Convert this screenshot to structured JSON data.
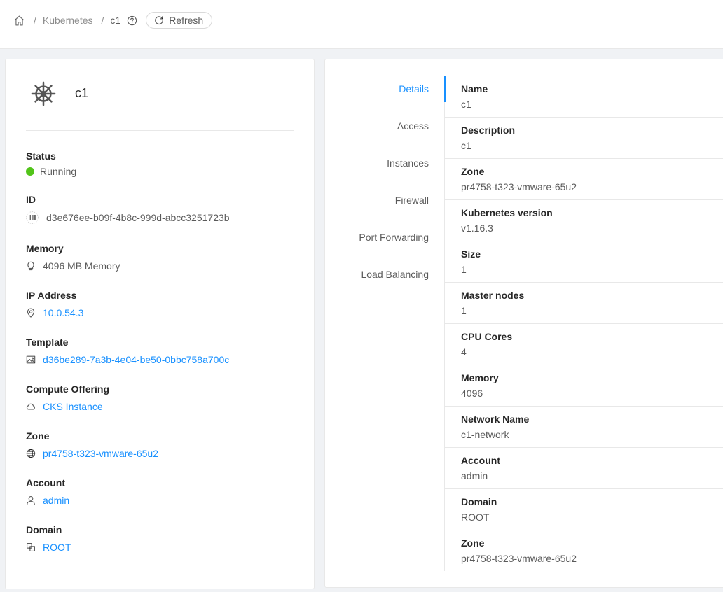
{
  "breadcrumb": {
    "home_icon": "home-icon",
    "sep": "/",
    "section": "Kubernetes",
    "current": "c1",
    "help_icon": "question-circle-icon",
    "refresh_label": "Refresh"
  },
  "resource": {
    "icon": "kubernetes-helm-icon",
    "name": "c1"
  },
  "info": {
    "status_label": "Status",
    "status_value": "Running",
    "status_color": "#52c41a",
    "id_label": "ID",
    "id_value": "d3e676ee-b09f-4b8c-999d-abcc3251723b",
    "memory_label": "Memory",
    "memory_value": "4096 MB Memory",
    "ip_label": "IP Address",
    "ip_value": "10.0.54.3",
    "template_label": "Template",
    "template_value": "d36be289-7a3b-4e04-be50-0bbc758a700c",
    "offering_label": "Compute Offering",
    "offering_value": "CKS Instance",
    "zone_label": "Zone",
    "zone_value": "pr4758-t323-vmware-65u2",
    "account_label": "Account",
    "account_value": "admin",
    "domain_label": "Domain",
    "domain_value": "ROOT"
  },
  "tabs": [
    {
      "label": "Details",
      "active": true
    },
    {
      "label": "Access",
      "active": false
    },
    {
      "label": "Instances",
      "active": false
    },
    {
      "label": "Firewall",
      "active": false
    },
    {
      "label": "Port Forwarding",
      "active": false
    },
    {
      "label": "Load Balancing",
      "active": false
    }
  ],
  "details": [
    {
      "label": "Name",
      "value": "c1"
    },
    {
      "label": "Description",
      "value": "c1"
    },
    {
      "label": "Zone",
      "value": "pr4758-t323-vmware-65u2"
    },
    {
      "label": "Kubernetes version",
      "value": "v1.16.3"
    },
    {
      "label": "Size",
      "value": "1"
    },
    {
      "label": "Master nodes",
      "value": "1"
    },
    {
      "label": "CPU Cores",
      "value": "4"
    },
    {
      "label": "Memory",
      "value": "4096"
    },
    {
      "label": "Network Name",
      "value": "c1-network"
    },
    {
      "label": "Account",
      "value": "admin"
    },
    {
      "label": "Domain",
      "value": "ROOT"
    },
    {
      "label": "Zone",
      "value": "pr4758-t323-vmware-65u2"
    }
  ],
  "colors": {
    "accent": "#1890ff",
    "running": "#52c41a"
  }
}
